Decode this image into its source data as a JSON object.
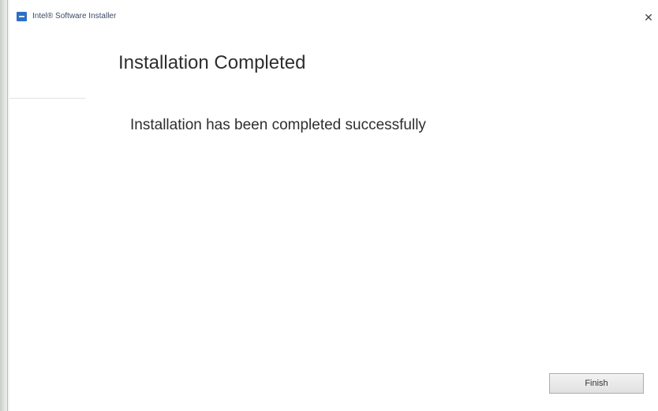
{
  "window": {
    "title": "Intel® Software Installer",
    "close_label": "✕"
  },
  "page": {
    "title": "Installation Completed",
    "message": "Installation has been completed successfully"
  },
  "buttons": {
    "finish_label": "Finish"
  },
  "icons": {
    "app": "intel-installer-icon",
    "close": "close-icon"
  },
  "colors": {
    "app_icon": "#2d6fc4",
    "title_text": "#3b4a66",
    "button_bg": "#e1e1e1",
    "button_border": "#adadad"
  }
}
